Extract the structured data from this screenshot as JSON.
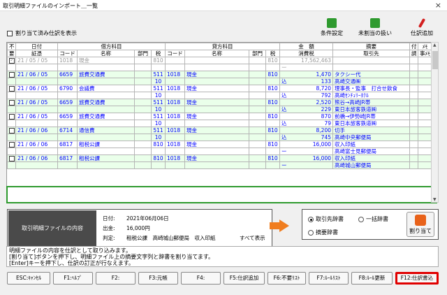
{
  "window": {
    "title": "取引明細ファイルのインポート＿一覧",
    "close_label": "×"
  },
  "options": {
    "show_assigned_label": "割り当て済み仕訳を表示",
    "show_assigned_checked": false
  },
  "toolbar": [
    {
      "label": "条件設定",
      "icon": "settings-icon",
      "color": "#2e9a2e"
    },
    {
      "label": "未割当の扱い",
      "icon": "document-icon",
      "color": "#2e9a2e"
    },
    {
      "label": "仕訳追加",
      "icon": "pencil-icon",
      "color": "#d32020"
    }
  ],
  "grid": {
    "top_headers": [
      "不",
      "日付",
      "借方科目",
      "貸方科目",
      "金　額",
      "摘要",
      "付",
      "ﾒﾓ"
    ],
    "sub_headers": [
      "要",
      "証憑",
      "コード",
      "名称",
      "部門",
      "税",
      "コード",
      "名称",
      "部門",
      "税",
      "消費税",
      "取引先",
      "調",
      "事ﾒﾓ"
    ],
    "rows": [
      {
        "checked": true,
        "gray": true,
        "date": "21 / 05 / 05",
        "dr_code": "1018",
        "dr_name": "現金",
        "dr_dept": "",
        "dr_tax": "810",
        "cr_code": "",
        "cr_name": "",
        "cr_dept": "",
        "cr_tax": "810",
        "amount": "17,562,463",
        "memo": "",
        "sub_dr_tax": "",
        "sub_cr_tax": "",
        "tax_kind": "ー",
        "tax_amount": "",
        "partner": ""
      },
      {
        "checked": false,
        "gray": false,
        "date": "21 / 06 / 05",
        "dr_code": "6659",
        "dr_name": "旅費交通費",
        "dr_dept": "",
        "dr_tax": "511",
        "cr_code": "1018",
        "cr_name": "現金",
        "cr_dept": "",
        "cr_tax": "810",
        "amount": "1,470",
        "memo": "タクシー代",
        "sub_dr_tax": "10",
        "sub_cr_tax": "",
        "tax_kind": "込",
        "tax_amount": "133",
        "partner": "高崎交通㈱"
      },
      {
        "checked": false,
        "gray": false,
        "date": "21 / 06 / 05",
        "dr_code": "6790",
        "dr_name": "会議費",
        "dr_dept": "",
        "dr_tax": "511",
        "cr_code": "1018",
        "cr_name": "現金",
        "cr_dept": "",
        "cr_tax": "810",
        "amount": "8,720",
        "memo": "理事長・監事　打合せ飲食",
        "sub_dr_tax": "10",
        "sub_cr_tax": "",
        "tax_kind": "込",
        "tax_amount": "792",
        "partner": "高崎ｾﾝﾁｭﾘｰﾎﾃﾙ"
      },
      {
        "checked": false,
        "gray": false,
        "date": "21 / 06 / 05",
        "dr_code": "6659",
        "dr_name": "旅費交通費",
        "dr_dept": "",
        "dr_tax": "511",
        "cr_code": "1018",
        "cr_name": "現金",
        "cr_dept": "",
        "cr_tax": "810",
        "amount": "2,520",
        "memo": "熊谷→高崎JR帯",
        "sub_dr_tax": "10",
        "sub_cr_tax": "",
        "tax_kind": "込",
        "tax_amount": "229",
        "partner": "東日本旅客鉄道㈱"
      },
      {
        "checked": false,
        "gray": false,
        "date": "21 / 06 / 05",
        "dr_code": "6659",
        "dr_name": "旅費交通費",
        "dr_dept": "",
        "dr_tax": "511",
        "cr_code": "1018",
        "cr_name": "現金",
        "cr_dept": "",
        "cr_tax": "810",
        "amount": "870",
        "memo": "前橋→伊勢崎JR帯",
        "sub_dr_tax": "10",
        "sub_cr_tax": "",
        "tax_kind": "込",
        "tax_amount": "79",
        "partner": "東日本旅客鉄道㈱"
      },
      {
        "checked": false,
        "gray": false,
        "date": "21 / 06 / 06",
        "dr_code": "6714",
        "dr_name": "通信費",
        "dr_dept": "",
        "dr_tax": "511",
        "cr_code": "1018",
        "cr_name": "現金",
        "cr_dept": "",
        "cr_tax": "810",
        "amount": "8,200",
        "memo": "切手",
        "sub_dr_tax": "10",
        "sub_cr_tax": "",
        "tax_kind": "込",
        "tax_amount": "745",
        "partner": "高崎中央郵便局"
      },
      {
        "checked": false,
        "gray": false,
        "date": "21 / 06 / 06",
        "dr_code": "6817",
        "dr_name": "租税公課",
        "dr_dept": "",
        "dr_tax": "810",
        "cr_code": "1018",
        "cr_name": "現金",
        "cr_dept": "",
        "cr_tax": "810",
        "amount": "16,000",
        "memo": "収入印紙",
        "sub_dr_tax": "",
        "sub_cr_tax": "",
        "tax_kind": "ー",
        "tax_amount": "",
        "partner": "高崎富士見郵便局"
      },
      {
        "checked": false,
        "gray": false,
        "date": "21 / 06 / 06",
        "dr_code": "6817",
        "dr_name": "租税公課",
        "dr_dept": "",
        "dr_tax": "810",
        "cr_code": "1018",
        "cr_name": "現金",
        "cr_dept": "",
        "cr_tax": "810",
        "amount": "16,000",
        "memo": "収入印紙",
        "sub_dr_tax": "",
        "sub_cr_tax": "",
        "tax_kind": "ー",
        "tax_amount": "",
        "partner": "高崎城山郵便局"
      }
    ]
  },
  "info": {
    "label": "取引明細ファイルの内容",
    "date_label": "日付:",
    "date_value": "2021年06月06日",
    "out_label": "出金:",
    "out_value": "16,000円",
    "judge_label": "判定:",
    "judge_value": "租税公課　高崎城山郵便局　収入印紙",
    "show_all": "すべて表示"
  },
  "dict": {
    "opt1": "取引先辞書",
    "opt2": "一括辞書",
    "opt3": "摘要辞書",
    "selected": "opt1",
    "assign_label": "割り当て"
  },
  "message": [
    "明細ファイルの内容を仕訳として取り込みます。",
    "[割り当て]ボタンを押下し、明細ファイル上の摘要文字列と辞書を割り当てます。",
    "[Enter]キーを押下し、仕訳の訂正が行なえます。"
  ],
  "fkeys": [
    {
      "label": "ESC:ｷｬﾝｾﾙ",
      "hl": false
    },
    {
      "label": "F1:ﾍﾙﾌﾟ",
      "hl": false
    },
    {
      "label": "F2:",
      "hl": false
    },
    {
      "label": "F3:元帳",
      "hl": false
    },
    {
      "label": "F4:",
      "hl": false
    },
    {
      "label": "F5:仕訳追加",
      "hl": false
    },
    {
      "label": "F6:不要ﾘｽﾄ",
      "hl": false
    },
    {
      "label": "F7:ﾙｰﾙﾘｽﾄ",
      "hl": false
    },
    {
      "label": "F8:ﾙｰﾙ更新",
      "hl": false
    },
    {
      "label": "F12:仕訳書込",
      "hl": true
    }
  ]
}
